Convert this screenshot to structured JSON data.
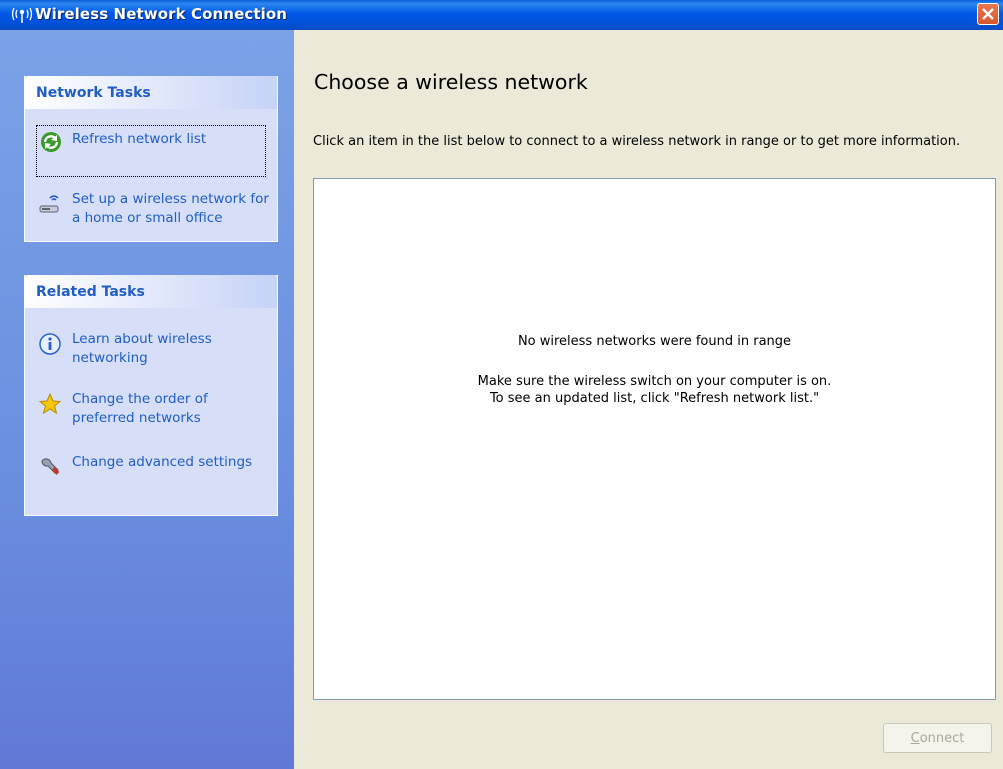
{
  "window": {
    "title": "Wireless Network Connection"
  },
  "sidebar": {
    "network_tasks": {
      "header": "Network Tasks",
      "items": [
        {
          "label": "Refresh network list",
          "icon": "refresh-icon"
        },
        {
          "label": "Set up a wireless network for a home or small office",
          "icon": "wireless-setup-icon"
        }
      ]
    },
    "related_tasks": {
      "header": "Related Tasks",
      "items": [
        {
          "label": "Learn about wireless networking",
          "icon": "info-icon"
        },
        {
          "label": "Change the order of preferred networks",
          "icon": "star-icon"
        },
        {
          "label": "Change advanced settings",
          "icon": "wrench-icon"
        }
      ]
    }
  },
  "main": {
    "title": "Choose a wireless network",
    "instructions": "Click an item in the list below to connect to a wireless network in range or to get more information.",
    "empty_message": "No wireless networks were found in range",
    "hint_line1": "Make sure the wireless switch on your computer is on.",
    "hint_line2": "To see an updated list, click \"Refresh network list.\"",
    "connect_label_first": "C",
    "connect_label_rest": "onnect"
  },
  "colors": {
    "title_bar": "#0058e6",
    "link": "#215dc6",
    "close_button": "#e06a40",
    "task_pane": "#7ba2e7"
  }
}
